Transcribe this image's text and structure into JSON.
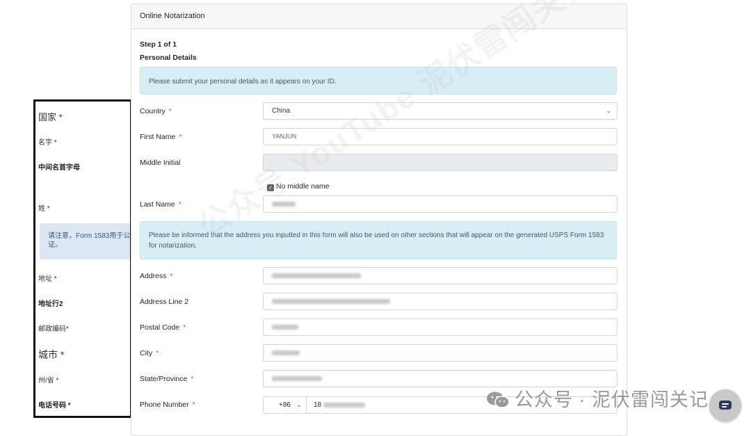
{
  "form": {
    "title": "Online Notarization",
    "step": "Step 1 of 1",
    "section": "Personal Details",
    "info_personal": "Please submit your personal details as it appears on your ID.",
    "info_address": "Please be informed that the address you inputted in this form will also be used on other sections that will appear on the generated USPS Form 1583 for notarization.",
    "required_mark": "*",
    "fields": {
      "country": {
        "label": "Country",
        "value": "China"
      },
      "first_name": {
        "label": "First Name",
        "value": "YANJUN"
      },
      "middle_initial": {
        "label": "Middle Initial",
        "value": ""
      },
      "no_middle_name": {
        "label": "No middle name",
        "checked": true
      },
      "last_name": {
        "label": "Last Name"
      },
      "address": {
        "label": "Address"
      },
      "address2": {
        "label": "Address Line 2"
      },
      "postal_code": {
        "label": "Postal Code"
      },
      "city": {
        "label": "City"
      },
      "state": {
        "label": "State/Province"
      },
      "phone": {
        "label": "Phone Number",
        "country_code": "+86",
        "value": "18"
      }
    }
  },
  "annotations": {
    "country": "国家 *",
    "first_name": "名字 *",
    "middle_initial": "中间名首字母",
    "last_name": "姓 *",
    "note": "请注意，Form 1583用于公证。",
    "address": "地址 *",
    "address2": "地址行2",
    "postal_code": "邮政编码*",
    "city": "城市 *",
    "state": "州/省 *",
    "phone": "电话号码 *"
  },
  "watermark": {
    "diagonal": "公众号 YouTube 泥伏雷闯关记",
    "bottom": "公众号 · 泥伏雷闯关记"
  }
}
